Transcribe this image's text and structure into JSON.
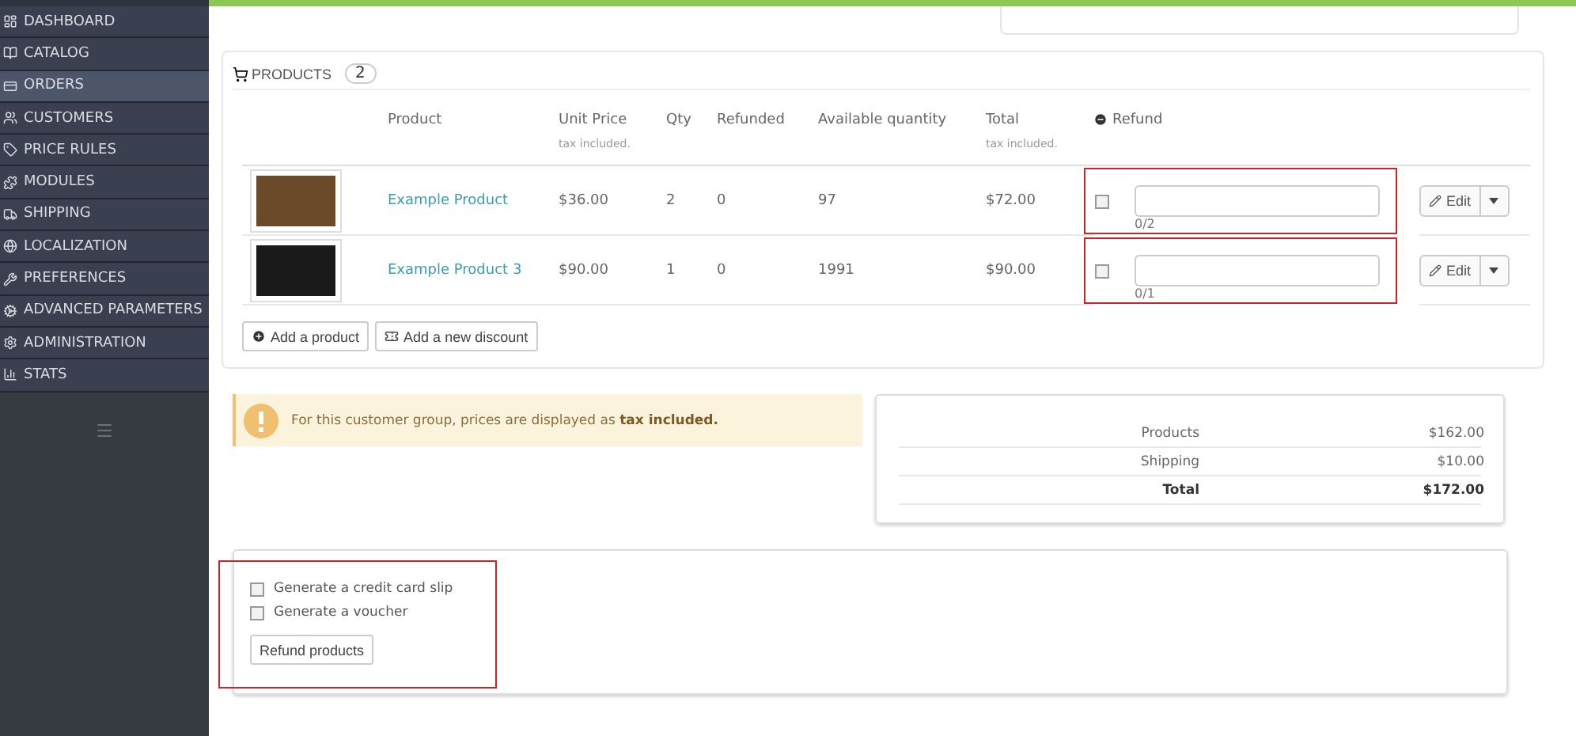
{
  "sidebar": {
    "items": [
      {
        "label": "DASHBOARD",
        "selected": false
      },
      {
        "label": "CATALOG",
        "selected": false
      },
      {
        "label": "ORDERS",
        "selected": true
      },
      {
        "label": "CUSTOMERS",
        "selected": false
      },
      {
        "label": "PRICE RULES",
        "selected": false
      },
      {
        "label": "MODULES",
        "selected": false
      },
      {
        "label": "SHIPPING",
        "selected": false
      },
      {
        "label": "LOCALIZATION",
        "selected": false
      },
      {
        "label": "PREFERENCES",
        "selected": false
      },
      {
        "label": "ADVANCED PARAMETERS",
        "selected": false
      },
      {
        "label": "ADMINISTRATION",
        "selected": false
      },
      {
        "label": "STATS",
        "selected": false
      }
    ]
  },
  "products_panel": {
    "title": "PRODUCTS",
    "count": "2",
    "columns": [
      {
        "label": "Product"
      },
      {
        "label": "Unit Price",
        "note": "tax included."
      },
      {
        "label": "Qty"
      },
      {
        "label": "Refunded"
      },
      {
        "label": "Available quantity"
      },
      {
        "label": "Total",
        "note": "tax included."
      },
      {
        "label": "Refund"
      }
    ],
    "rows": [
      {
        "name": "Example Product",
        "unit_price": "$36.00",
        "qty": "2",
        "refunded": "0",
        "available": "97",
        "total": "$72.00",
        "refund_checked": false,
        "refund_max": "0/2",
        "highlighted": true,
        "edit": "Edit"
      },
      {
        "name": "Example Product 3",
        "unit_price": "$90.00",
        "qty": "1",
        "refunded": "0",
        "available": "1991",
        "total": "$90.00",
        "refund_checked": false,
        "refund_max": "0/1",
        "highlighted": true,
        "edit": "Edit"
      }
    ],
    "buttons": [
      "Add a product",
      "Add a new discount"
    ]
  },
  "alert": {
    "text": "For this customer group, prices are displayed as **tax included.**"
  },
  "totals": [
    {
      "label": "Products",
      "value": "$162.00",
      "bold": false
    },
    {
      "label": "Shipping",
      "value": "$10.00",
      "bold": false
    },
    {
      "label": "Total",
      "value": "$172.00",
      "bold": true
    }
  ],
  "refund_panel": {
    "highlighted": true,
    "options": [
      {
        "label": "Generate a credit card slip",
        "checked": false
      },
      {
        "label": "Generate a voucher",
        "checked": false
      }
    ],
    "button": "Refund products"
  }
}
